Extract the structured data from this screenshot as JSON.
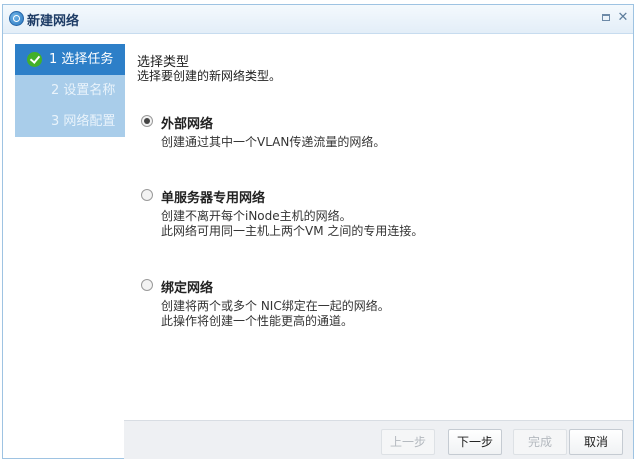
{
  "window": {
    "title": "新建网络"
  },
  "sidebar": {
    "steps": [
      {
        "label": "1 选择任务",
        "state": "done"
      },
      {
        "label": "2 设置名称",
        "state": "pending"
      },
      {
        "label": "3 网络配置",
        "state": "pending"
      }
    ]
  },
  "main": {
    "title": "选择类型",
    "subtitle": "选择要创建的新网络类型。",
    "options": [
      {
        "label": "外部网络",
        "selected": true,
        "desc": [
          "创建通过其中一个VLAN传递流量的网络。"
        ]
      },
      {
        "label": "单服务器专用网络",
        "selected": false,
        "desc": [
          "创建不离开每个iNode主机的网络。",
          "此网络可用同一主机上两个VM 之间的专用连接。"
        ]
      },
      {
        "label": "绑定网络",
        "selected": false,
        "desc": [
          "创建将两个或多个 NIC绑定在一起的网络。",
          "此操作将创建一个性能更高的通道。"
        ]
      }
    ]
  },
  "footer": {
    "prev": "上一步",
    "next": "下一步",
    "finish": "完成",
    "cancel": "取消"
  },
  "colors": {
    "step_active": "#2d7fc8",
    "step_inactive": "#a9cdea",
    "check": "#43b02a"
  }
}
